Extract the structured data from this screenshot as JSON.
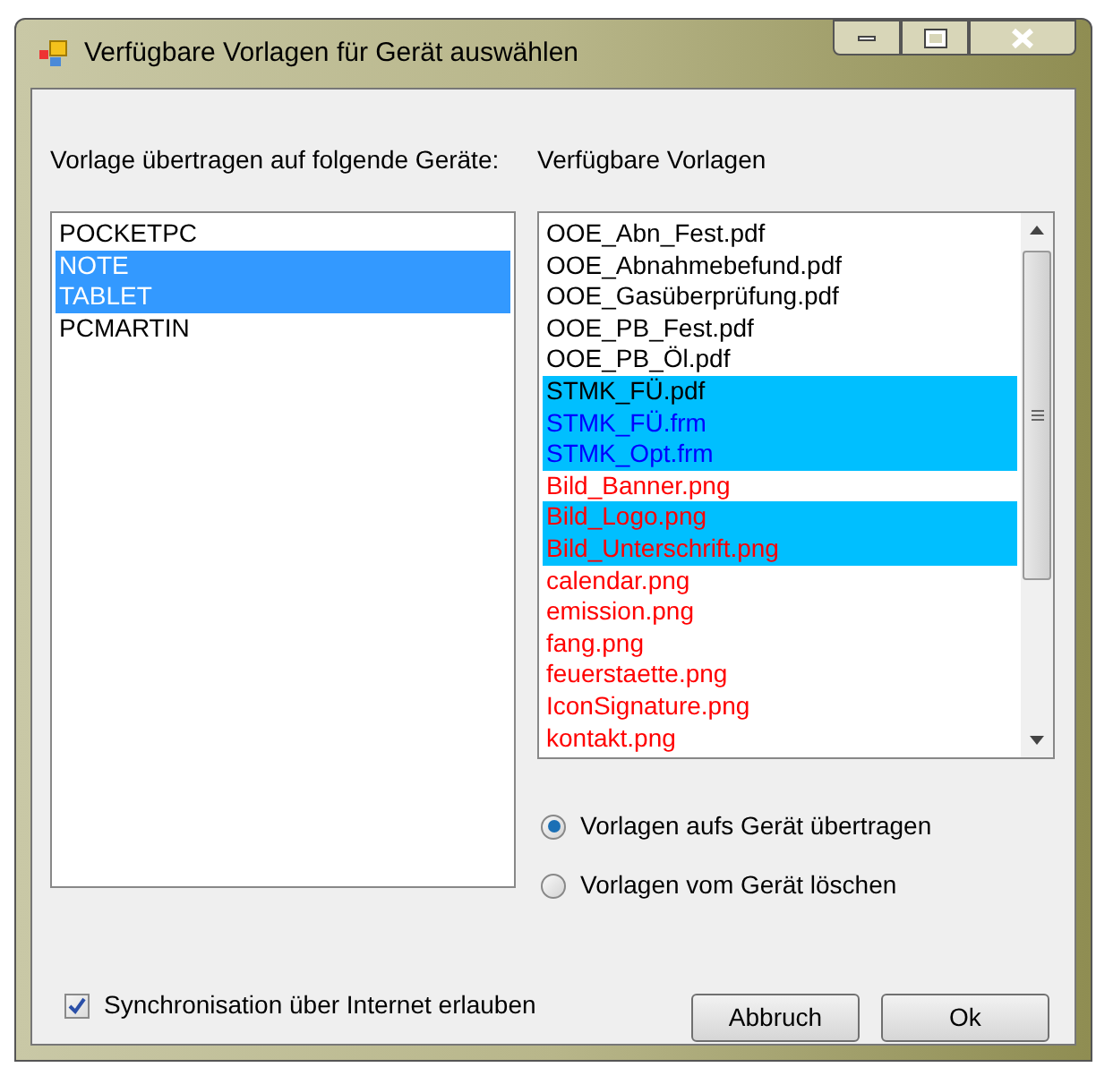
{
  "window": {
    "title": "Verfügbare Vorlagen für Gerät auswählen"
  },
  "devices": {
    "label": "Vorlage übertragen auf folgende Geräte:",
    "items": [
      {
        "text": "POCKETPC",
        "selected": false
      },
      {
        "text": "NOTE",
        "selected": true
      },
      {
        "text": "TABLET",
        "selected": true
      },
      {
        "text": "PCMARTIN",
        "selected": false
      }
    ]
  },
  "templates": {
    "label": "Verfügbare Vorlagen",
    "items": [
      {
        "text": "OOE_Abn_Fest.pdf",
        "selected": false,
        "kind": "document"
      },
      {
        "text": "OOE_Abnahmebefund.pdf",
        "selected": false,
        "kind": "document"
      },
      {
        "text": "OOE_Gasüberprüfung.pdf",
        "selected": false,
        "kind": "document"
      },
      {
        "text": "OOE_PB_Fest.pdf",
        "selected": false,
        "kind": "document"
      },
      {
        "text": "OOE_PB_Öl.pdf",
        "selected": false,
        "kind": "document"
      },
      {
        "text": "STMK_FÜ.pdf",
        "selected": true,
        "kind": "document"
      },
      {
        "text": "STMK_FÜ.frm",
        "selected": true,
        "kind": "form"
      },
      {
        "text": "STMK_Opt.frm",
        "selected": true,
        "kind": "form"
      },
      {
        "text": "Bild_Banner.png",
        "selected": false,
        "kind": "image"
      },
      {
        "text": "Bild_Logo.png",
        "selected": true,
        "kind": "image"
      },
      {
        "text": "Bild_Unterschrift.png",
        "selected": true,
        "kind": "image"
      },
      {
        "text": "calendar.png",
        "selected": false,
        "kind": "image"
      },
      {
        "text": "emission.png",
        "selected": false,
        "kind": "image"
      },
      {
        "text": "fang.png",
        "selected": false,
        "kind": "image"
      },
      {
        "text": "feuerstaette.png",
        "selected": false,
        "kind": "image"
      },
      {
        "text": "IconSignature.png",
        "selected": false,
        "kind": "image"
      },
      {
        "text": "kontakt.png",
        "selected": false,
        "kind": "image"
      }
    ]
  },
  "mode": [
    {
      "label": "Vorlagen aufs Gerät übertragen",
      "selected": true
    },
    {
      "label": "Vorlagen vom Gerät löschen",
      "selected": false
    }
  ],
  "sync": {
    "label": "Synchronisation über Internet erlauben",
    "checked": true
  },
  "buttons": [
    "Abbruch",
    "Ok"
  ]
}
